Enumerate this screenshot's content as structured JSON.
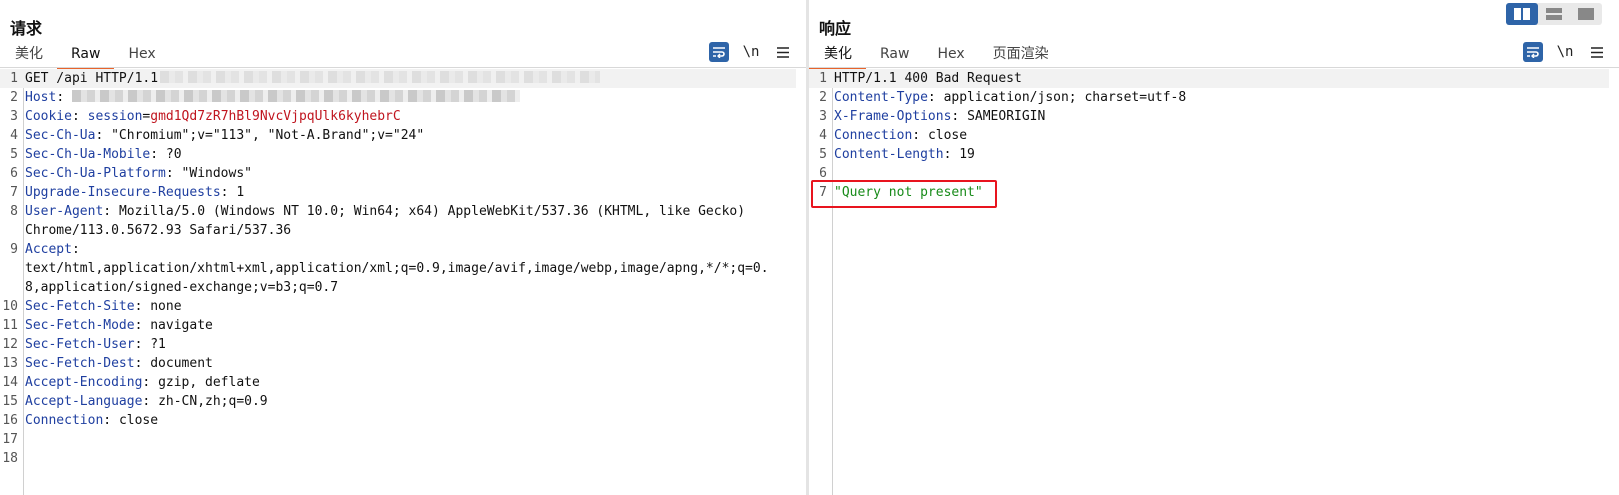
{
  "request": {
    "title": "请求",
    "tabs": [
      {
        "label": "美化",
        "active": false
      },
      {
        "label": "Raw",
        "active": true
      },
      {
        "label": "Hex",
        "active": false
      }
    ],
    "tools": {
      "wrap_icon": "wrap-lines-icon",
      "newline_label": "\\n",
      "menu_icon": "menu-icon"
    },
    "lines": [
      {
        "n": "1",
        "text": "GET /api HTTP/1.1",
        "redacted_after": true
      },
      {
        "n": "2",
        "key": "Host",
        "value": "",
        "redacted": true
      },
      {
        "n": "3",
        "key": "Cookie",
        "cookie_name": "session",
        "cookie_value": "gmd1Qd7zR7hBl9NvcVjpqUlk6kyhebrC"
      },
      {
        "n": "4",
        "key": "Sec-Ch-Ua",
        "value": "\"Chromium\";v=\"113\", \"Not-A.Brand\";v=\"24\""
      },
      {
        "n": "5",
        "key": "Sec-Ch-Ua-Mobile",
        "value": "?0"
      },
      {
        "n": "6",
        "key": "Sec-Ch-Ua-Platform",
        "value": "\"Windows\""
      },
      {
        "n": "7",
        "key": "Upgrade-Insecure-Requests",
        "value": "1"
      },
      {
        "n": "8",
        "key": "User-Agent",
        "value": "Mozilla/5.0 (Windows NT 10.0; Win64; x64) AppleWebKit/537.36 (KHTML, like Gecko)",
        "continuation": "Chrome/113.0.5672.93 Safari/537.36"
      },
      {
        "n": "9",
        "key": "Accept",
        "value": "",
        "continuation": "text/html,application/xhtml+xml,application/xml;q=0.9,image/avif,image/webp,image/apng,*/*;q=0.",
        "continuation2": "8,application/signed-exchange;v=b3;q=0.7"
      },
      {
        "n": "10",
        "key": "Sec-Fetch-Site",
        "value": "none"
      },
      {
        "n": "11",
        "key": "Sec-Fetch-Mode",
        "value": "navigate"
      },
      {
        "n": "12",
        "key": "Sec-Fetch-User",
        "value": "?1"
      },
      {
        "n": "13",
        "key": "Sec-Fetch-Dest",
        "value": "document"
      },
      {
        "n": "14",
        "key": "Accept-Encoding",
        "value": "gzip, deflate"
      },
      {
        "n": "15",
        "key": "Accept-Language",
        "value": "zh-CN,zh;q=0.9"
      },
      {
        "n": "16",
        "key": "Connection",
        "value": "close"
      },
      {
        "n": "17",
        "text": ""
      },
      {
        "n": "18",
        "text": ""
      }
    ]
  },
  "response": {
    "title": "响应",
    "tabs": [
      {
        "label": "美化",
        "active": true
      },
      {
        "label": "Raw",
        "active": false
      },
      {
        "label": "Hex",
        "active": false
      },
      {
        "label": "页面渲染",
        "active": false
      }
    ],
    "tools": {
      "wrap_icon": "wrap-lines-icon",
      "newline_label": "\\n",
      "menu_icon": "menu-icon"
    },
    "lines": [
      {
        "n": "1",
        "text": "HTTP/1.1 400 Bad Request"
      },
      {
        "n": "2",
        "key": "Content-Type",
        "value": "application/json; charset=utf-8"
      },
      {
        "n": "3",
        "key": "X-Frame-Options",
        "value": "SAMEORIGIN"
      },
      {
        "n": "4",
        "key": "Connection",
        "value": "close"
      },
      {
        "n": "5",
        "key": "Content-Length",
        "value": "19"
      },
      {
        "n": "6",
        "text": ""
      },
      {
        "n": "7",
        "json": "\"Query not present\""
      }
    ]
  },
  "layout_buttons": [
    {
      "icon": "split-horizontal-icon",
      "active": true
    },
    {
      "icon": "split-vertical-icon",
      "active": false
    },
    {
      "icon": "single-pane-icon",
      "active": false
    }
  ],
  "colors": {
    "header_key": "#1f3fa0",
    "cookie_value": "#c0151f",
    "json_string": "#188b1a",
    "active_tab_underline": "#e8632b",
    "highlight_box": "#e8141e",
    "button_blue": "#2e64a8"
  }
}
